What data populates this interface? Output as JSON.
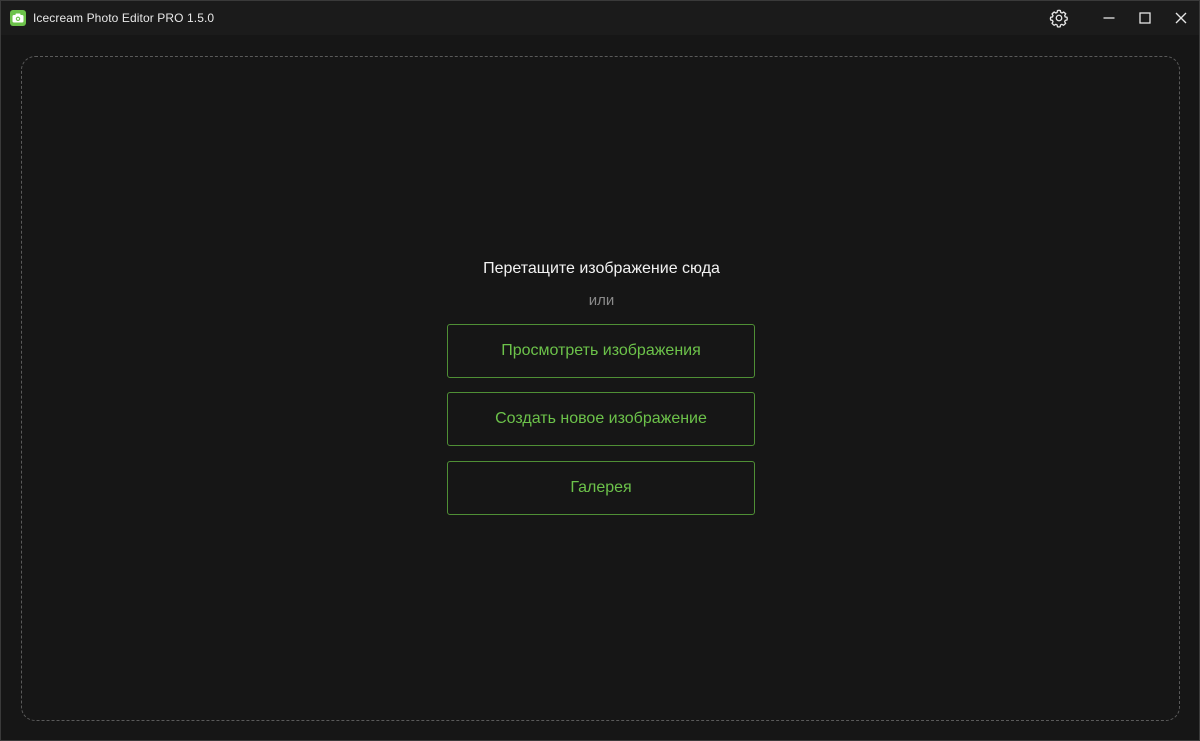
{
  "window": {
    "title": "Icecream Photo Editor PRO 1.5.0",
    "app_icon": "camera-icon",
    "accent_color": "#6cc24a",
    "background_color": "#161616"
  },
  "titlebar_controls": {
    "settings_icon": "gear-icon",
    "minimize_icon": "minimize-icon",
    "maximize_icon": "maximize-icon",
    "close_icon": "close-icon"
  },
  "dropzone": {
    "drag_text": "Перетащите изображение сюда",
    "or_text": "или",
    "buttons": [
      {
        "label": "Просмотреть изображения"
      },
      {
        "label": "Создать новое изображение"
      },
      {
        "label": "Галерея"
      }
    ]
  }
}
